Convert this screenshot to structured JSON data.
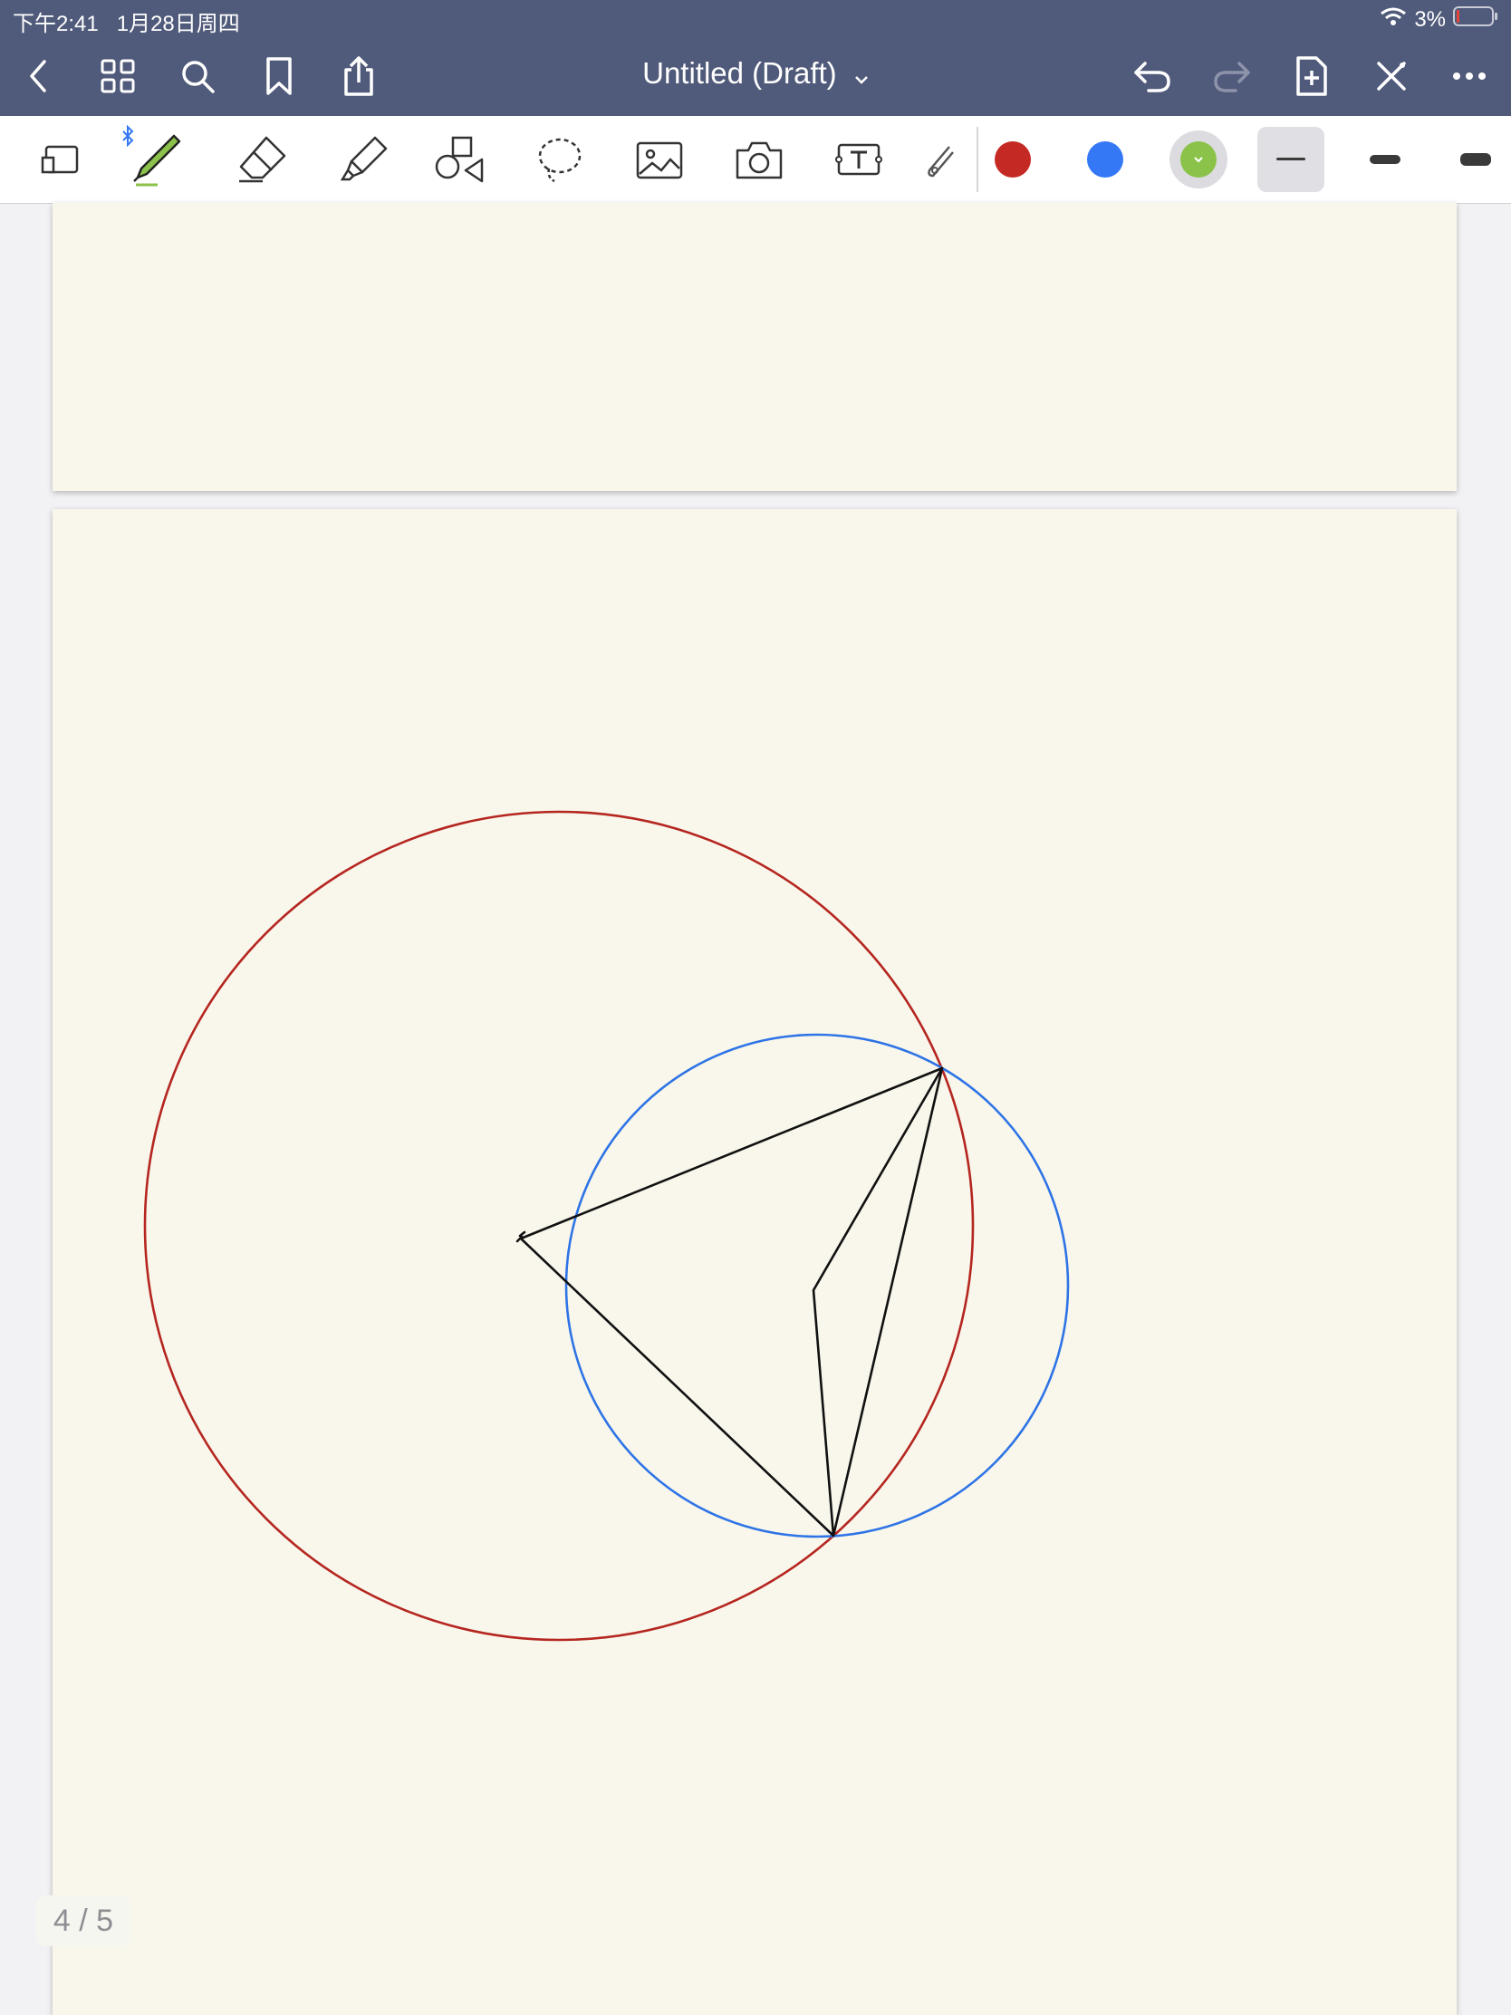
{
  "status": {
    "time": "下午2:41",
    "date": "1月28日周四",
    "battery": "3%"
  },
  "nav": {
    "title": "Untitled (Draft)"
  },
  "toolbar": {
    "colors": [
      "#c42a23",
      "#3478f6",
      "#8bc34a"
    ]
  },
  "drawing": {
    "red_circle_color": "#b52620",
    "blue_circle_color": "#2e74e6",
    "line_color": "#111111"
  },
  "page_counter": "4 / 5"
}
